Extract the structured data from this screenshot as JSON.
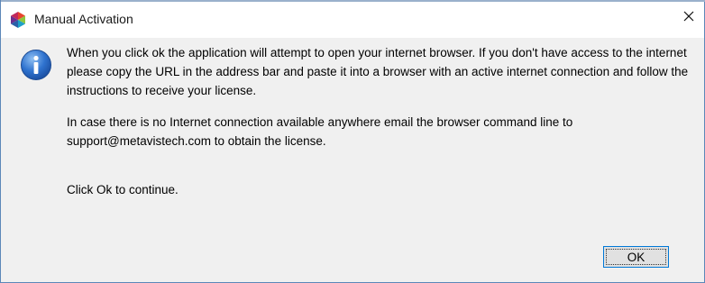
{
  "window": {
    "title": "Manual Activation",
    "app_icon": "metavis-logo-icon",
    "close_icon": "close-icon"
  },
  "message": {
    "icon": "info-icon",
    "paragraph1": "When you click ok the application will attempt to open your internet browser. If you don't have access to the internet please copy the URL in the address bar and paste it into a browser with an active internet connection and follow the instructions to receive your license.",
    "paragraph2": "In case there is no Internet connection available anywhere email the browser command line to support@metavistech.com to obtain the license.",
    "paragraph3": "Click Ok to continue."
  },
  "buttons": {
    "ok_label": "OK"
  },
  "colors": {
    "window_border": "#5c87b8",
    "dialog_background": "#f0f0f0",
    "button_focus_border": "#0078d7",
    "info_icon_blue": "#1f5fbf"
  }
}
